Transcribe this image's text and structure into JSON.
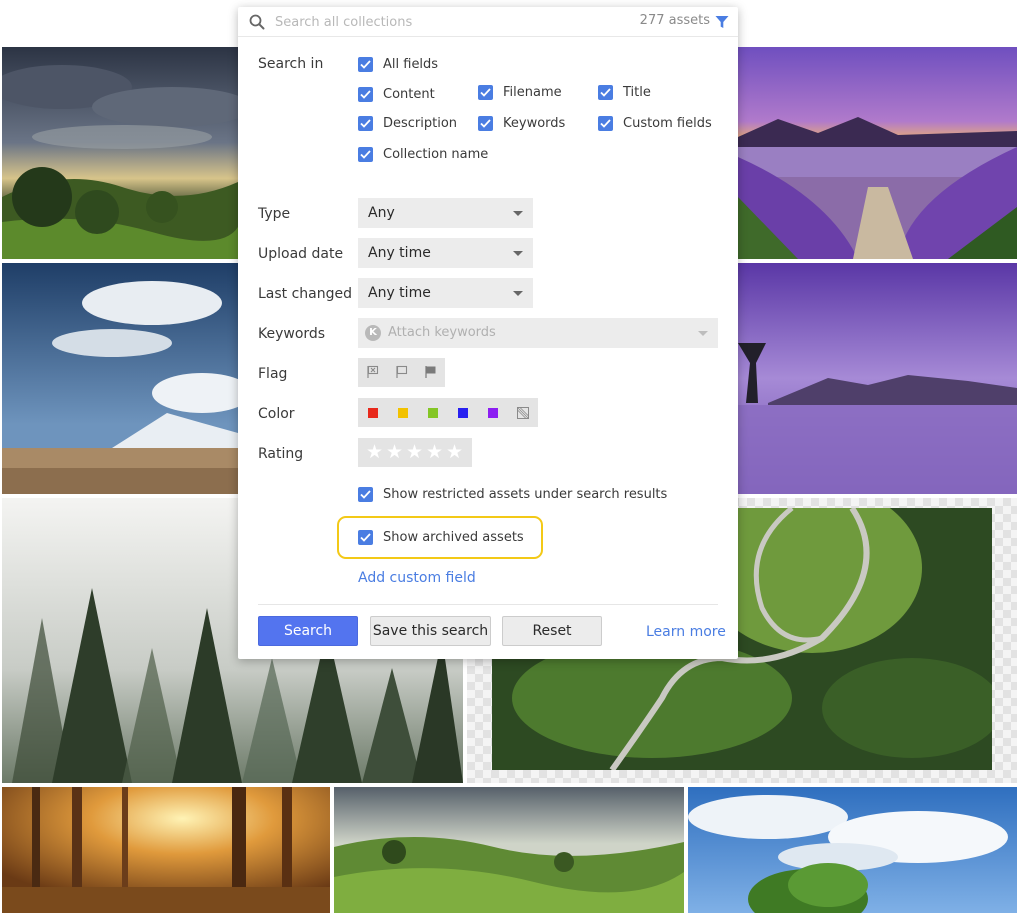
{
  "search": {
    "placeholder": "Search all collections",
    "count": "277 assets"
  },
  "search_in": {
    "label": "Search in",
    "options": {
      "all_fields": "All fields",
      "content": "Content",
      "filename": "Filename",
      "title": "Title",
      "description": "Description",
      "keywords": "Keywords",
      "custom_fields": "Custom fields",
      "collection_name": "Collection name"
    }
  },
  "filters": {
    "type": {
      "label": "Type",
      "value": "Any"
    },
    "upload_date": {
      "label": "Upload date",
      "value": "Any time"
    },
    "last_changed": {
      "label": "Last changed",
      "value": "Any time"
    },
    "keywords": {
      "label": "Keywords",
      "icon_letter": "K",
      "placeholder": "Attach keywords"
    },
    "flag": {
      "label": "Flag"
    },
    "color": {
      "label": "Color",
      "swatches": [
        "#e8291c",
        "#f2c200",
        "#84c625",
        "#2820f0",
        "#8c1ef2"
      ]
    },
    "rating": {
      "label": "Rating",
      "stars": 5
    }
  },
  "options": {
    "show_restricted": "Show restricted assets under search results",
    "show_archived": "Show archived assets",
    "add_custom_field": "Add custom field"
  },
  "actions": {
    "search": "Search",
    "save_search": "Save this search",
    "reset": "Reset",
    "learn_more": "Learn more"
  },
  "colors": {
    "accent": "#4a7de2",
    "primary_button": "#5374ef",
    "highlight": "#f3c917"
  }
}
